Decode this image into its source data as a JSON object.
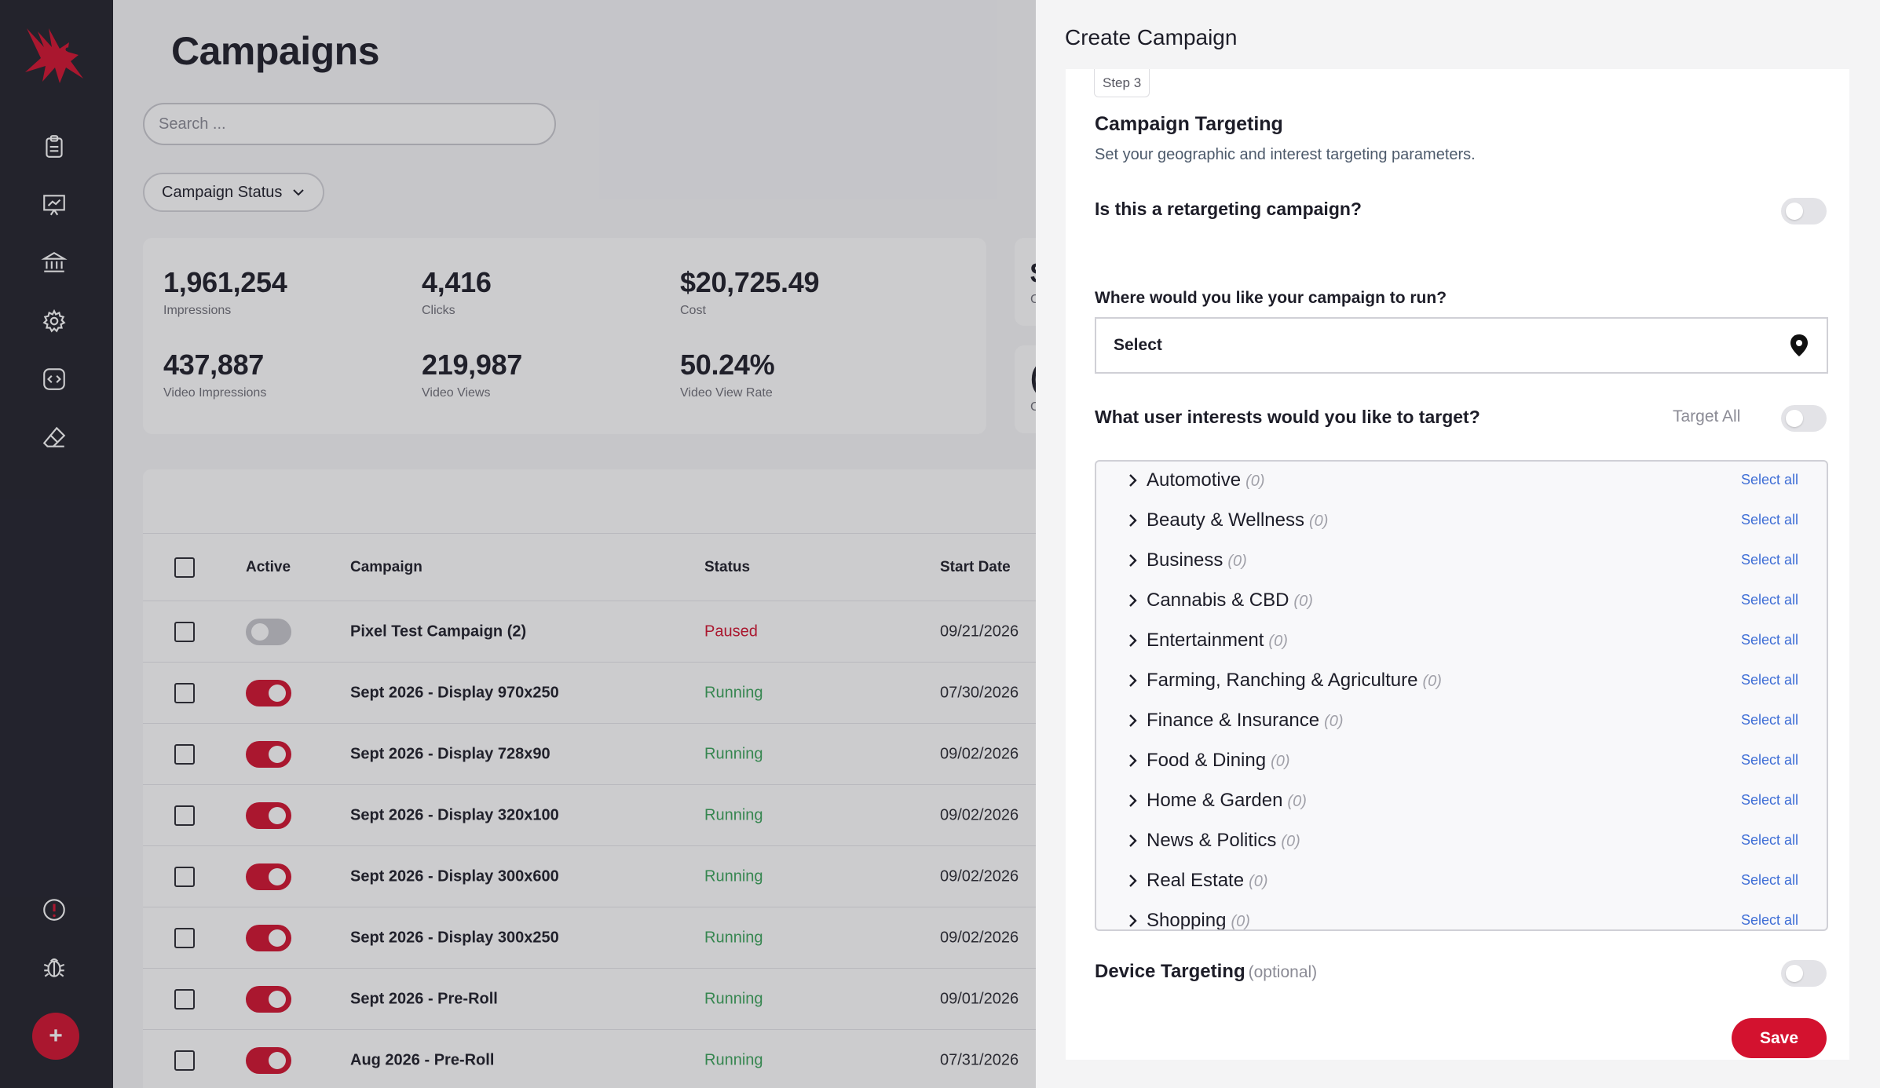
{
  "brand": {
    "accent": "#d3122f",
    "sidebar_bg": "#21222b",
    "logo": "red-bird-logo"
  },
  "sidebar": {
    "items": [
      {
        "icon": "clipboard-icon"
      },
      {
        "icon": "presentation-chart-icon"
      },
      {
        "icon": "bank-icon"
      },
      {
        "icon": "gear-icon"
      },
      {
        "icon": "code-icon"
      },
      {
        "icon": "eraser-icon"
      }
    ],
    "bottom": [
      {
        "icon": "alert-icon"
      },
      {
        "icon": "bug-icon"
      }
    ],
    "fab_label": "+"
  },
  "main": {
    "title": "Campaigns",
    "search_placeholder": "Search ...",
    "status_filter": "Campaign Status",
    "stats": [
      {
        "value": "1,961,254",
        "label": "Impressions"
      },
      {
        "value": "4,416",
        "label": "Clicks"
      },
      {
        "value": "$20,725.49",
        "label": "Cost"
      },
      {
        "value": "437,887",
        "label": "Video Impressions"
      },
      {
        "value": "219,987",
        "label": "Video Views"
      },
      {
        "value": "50.24%",
        "label": "Video View Rate"
      }
    ],
    "partial_stats": [
      "$",
      "("
    ],
    "partial_stat_labels": [
      "C",
      "C"
    ],
    "table": {
      "headers": {
        "active": "Active",
        "campaign": "Campaign",
        "status": "Status",
        "start_date": "Start Date"
      },
      "rows": [
        {
          "active": false,
          "campaign": "Pixel Test Campaign (2)",
          "status": "Paused",
          "start_date": "09/21/2026"
        },
        {
          "active": true,
          "campaign": "Sept 2026 - Display 970x250",
          "status": "Running",
          "start_date": "07/30/2026"
        },
        {
          "active": true,
          "campaign": "Sept 2026 - Display 728x90",
          "status": "Running",
          "start_date": "09/02/2026"
        },
        {
          "active": true,
          "campaign": "Sept 2026 - Display 320x100",
          "status": "Running",
          "start_date": "09/02/2026"
        },
        {
          "active": true,
          "campaign": "Sept 2026 - Display 300x600",
          "status": "Running",
          "start_date": "09/02/2026"
        },
        {
          "active": true,
          "campaign": "Sept 2026 - Display 300x250",
          "status": "Running",
          "start_date": "09/02/2026"
        },
        {
          "active": true,
          "campaign": "Sept 2026 - Pre-Roll",
          "status": "Running",
          "start_date": "09/01/2026"
        },
        {
          "active": true,
          "campaign": "Aug 2026 - Pre-Roll",
          "status": "Running",
          "start_date": "07/31/2026"
        }
      ]
    }
  },
  "drawer": {
    "title": "Create Campaign",
    "step": "Step 3",
    "section_title": "Campaign Targeting",
    "section_subtitle": "Set your geographic and interest targeting parameters.",
    "retargeting_question": "Is this a retargeting campaign?",
    "retargeting_on": false,
    "location_question": "Where would you like your campaign to run?",
    "location_value": "Select",
    "interests_question": "What user interests would you like to target?",
    "target_all_label": "Target All",
    "target_all_on": false,
    "select_all_label": "Select all",
    "interests": [
      {
        "name": "Automotive",
        "count": "(0)"
      },
      {
        "name": "Beauty & Wellness",
        "count": "(0)"
      },
      {
        "name": "Business",
        "count": "(0)"
      },
      {
        "name": "Cannabis & CBD",
        "count": "(0)"
      },
      {
        "name": "Entertainment",
        "count": "(0)"
      },
      {
        "name": "Farming, Ranching & Agriculture",
        "count": "(0)"
      },
      {
        "name": "Finance & Insurance",
        "count": "(0)"
      },
      {
        "name": "Food & Dining",
        "count": "(0)"
      },
      {
        "name": "Home & Garden",
        "count": "(0)"
      },
      {
        "name": "News & Politics",
        "count": "(0)"
      },
      {
        "name": "Real Estate",
        "count": "(0)"
      },
      {
        "name": "Shopping",
        "count": "(0)"
      }
    ],
    "device_label": "Device Targeting",
    "device_optional": "(optional)",
    "device_on": false,
    "save_label": "Save"
  }
}
